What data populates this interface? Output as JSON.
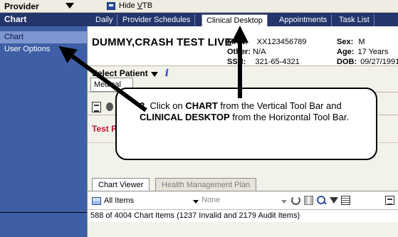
{
  "topbar": {
    "provider_label": "Provider",
    "hide_vtb_prefix": "Hide ",
    "hide_vtb_underlined": "V",
    "hide_vtb_suffix": "TB"
  },
  "sidebar": {
    "header": "Chart",
    "items": [
      {
        "label": "Chart",
        "active": true
      },
      {
        "label": "User Options",
        "active": false
      }
    ]
  },
  "tabs": [
    {
      "label": "Daily",
      "active": false
    },
    {
      "label": "Provider Schedules",
      "active": false
    },
    {
      "label": "Clinical Desktop",
      "active": true
    },
    {
      "label": "Appointments",
      "active": false
    },
    {
      "label": "Task List",
      "active": false
    }
  ],
  "patient": {
    "name": "DUMMY,CRASH TEST LIVE",
    "select_label": "Select Patient",
    "mrn_label": "MRN:",
    "mrn": "XX123456789",
    "other_label": "Other:",
    "other": "N/A",
    "ssn_label": "SSN:",
    "ssn": "321-65-4321",
    "sex_label": "Sex:",
    "sex": "M",
    "age_label": "Age:",
    "age": "17 Years",
    "dob_label": "DOB:",
    "dob": "09/27/1991"
  },
  "toolbar": {
    "medical_label": "Medical",
    "test_label": "Test P"
  },
  "viewer": {
    "subtabs": [
      {
        "label": "Chart Viewer",
        "active": true
      },
      {
        "label": "Health Management Plan",
        "active": false
      }
    ],
    "filter_value": "All Items",
    "secondary_value": "None",
    "count_text": "588 of 4004 Chart Items (1237 Invalid and 2179 Audit Items)"
  },
  "callout": {
    "number": "2.",
    "text_1": " Click on ",
    "bold_1": "CHART",
    "text_2": " from the Vertical Tool Bar and ",
    "bold_2": "CLINICAL DESKTOP",
    "text_3": " from the Horizontal Tool Bar."
  }
}
